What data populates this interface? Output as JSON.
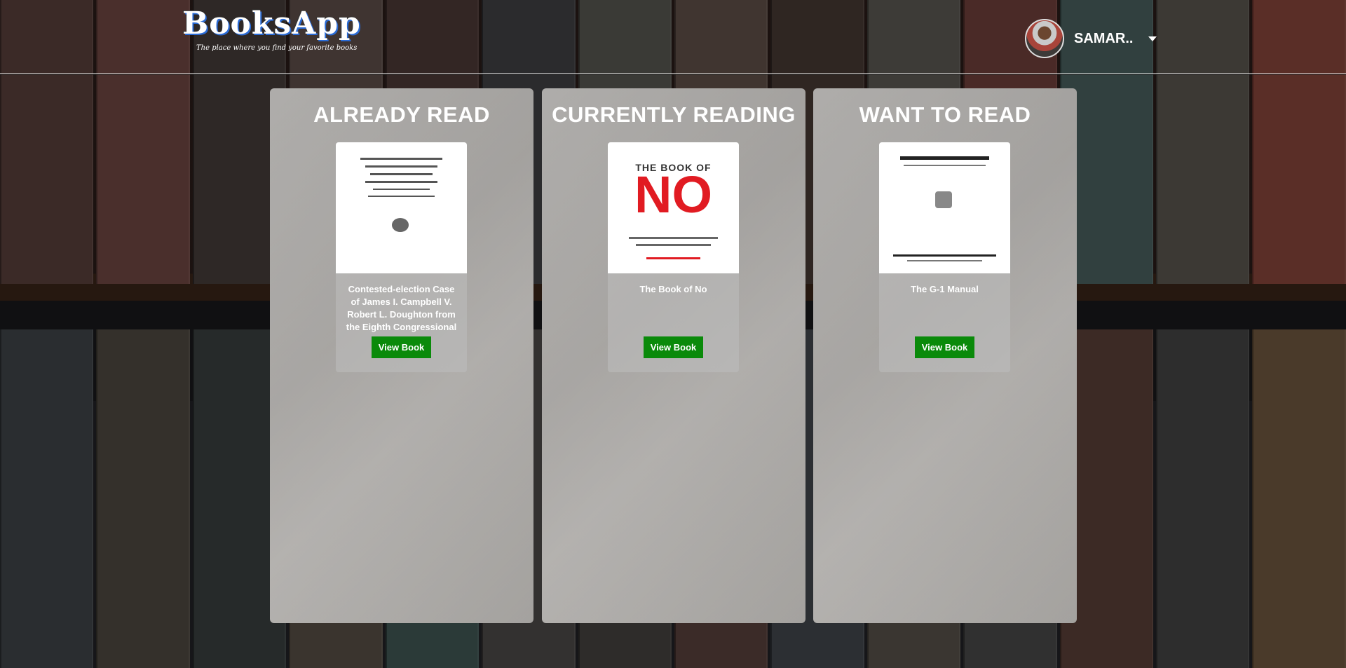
{
  "app": {
    "title": "BooksApp",
    "tagline": "The place where you find your favorite books"
  },
  "user": {
    "name": "SAMAR.."
  },
  "shelves": [
    {
      "title": "ALREADY READ",
      "books": [
        {
          "title": "Contested-election Case of James I. Campbell V. Robert L. Doughton from the Eighth Congressional District of North Carolina",
          "button": "View Book"
        }
      ]
    },
    {
      "title": "CURRENTLY READING",
      "books": [
        {
          "title": "The Book of No",
          "button": "View Book",
          "cover_text": {
            "top": "THE BOOK OF",
            "big": "NO"
          }
        }
      ]
    },
    {
      "title": "WANT TO READ",
      "books": [
        {
          "title": "The G-1 Manual",
          "button": "View Book"
        }
      ]
    }
  ],
  "colors": {
    "button_bg": "#0a8a0a",
    "cover_accent": "#e11b22"
  }
}
